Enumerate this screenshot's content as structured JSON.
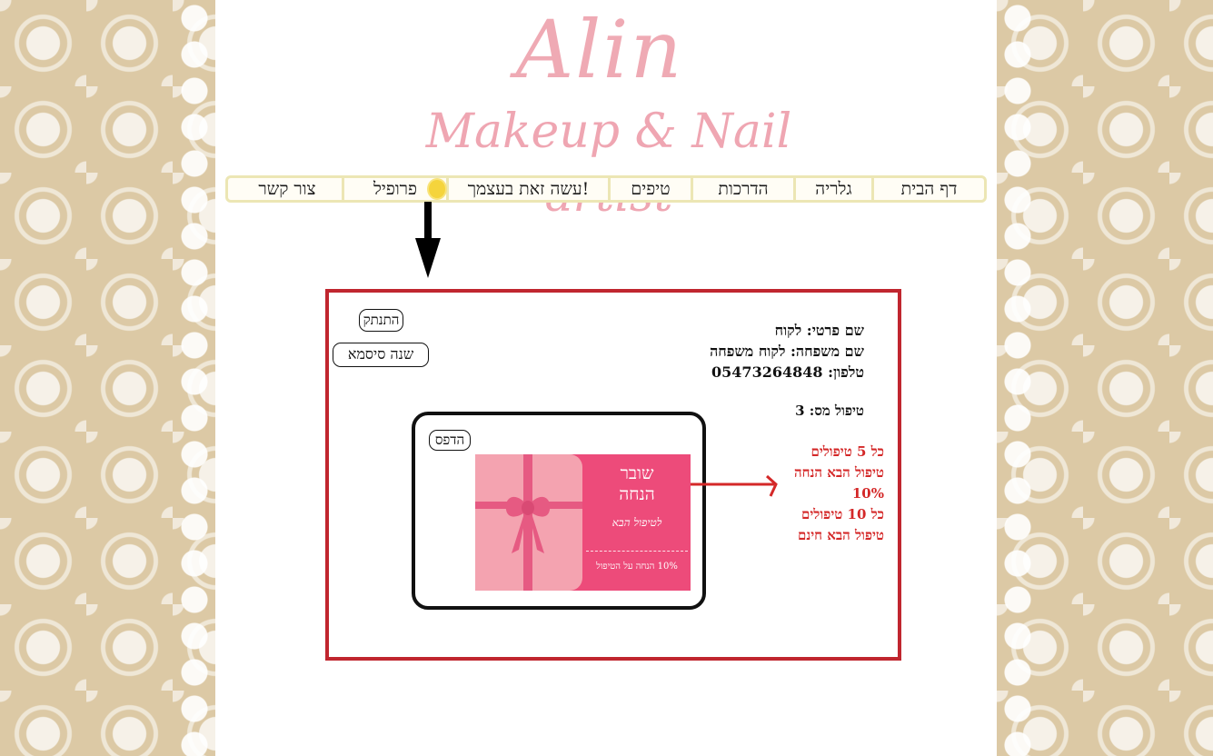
{
  "logo": {
    "name": "Alin",
    "tagline": "Makeup & Nail artist"
  },
  "nav": {
    "items": [
      {
        "label": "דף הבית"
      },
      {
        "label": "גלריה"
      },
      {
        "label": "הדרכות"
      },
      {
        "label": "טיפים"
      },
      {
        "label": "עשה זאת בעצמך!"
      },
      {
        "label": "פרופיל"
      },
      {
        "label": "צור קשר"
      }
    ],
    "active": "פרופיל"
  },
  "profile": {
    "disconnect_label": "התנתק",
    "change_password_label": "שנה סיסמא",
    "first_name_line": "שם פרטי: לקוח",
    "last_name_line": "שם משפחה: לקוח משפחה",
    "phone_line": "טלפון: 05473264848",
    "treatment_line": "טיפול מס: 3",
    "print_label": "הדפס",
    "promo": [
      "כל 5 טיפולים",
      "טיפול הבא הנחה",
      "10%",
      "כל 10 טיפולים",
      "טיפול הבא חינם"
    ]
  },
  "voucher": {
    "title_line1": "שובר",
    "title_line2": "הנחה",
    "subtitle": "לטיפול הבא",
    "footer": "10% הנחה על הטיפול"
  },
  "colors": {
    "accent_red": "#c0262f",
    "pink": "#ed4b7a",
    "logo_pink": "#efaab4",
    "nav_border": "#ece6b4"
  }
}
